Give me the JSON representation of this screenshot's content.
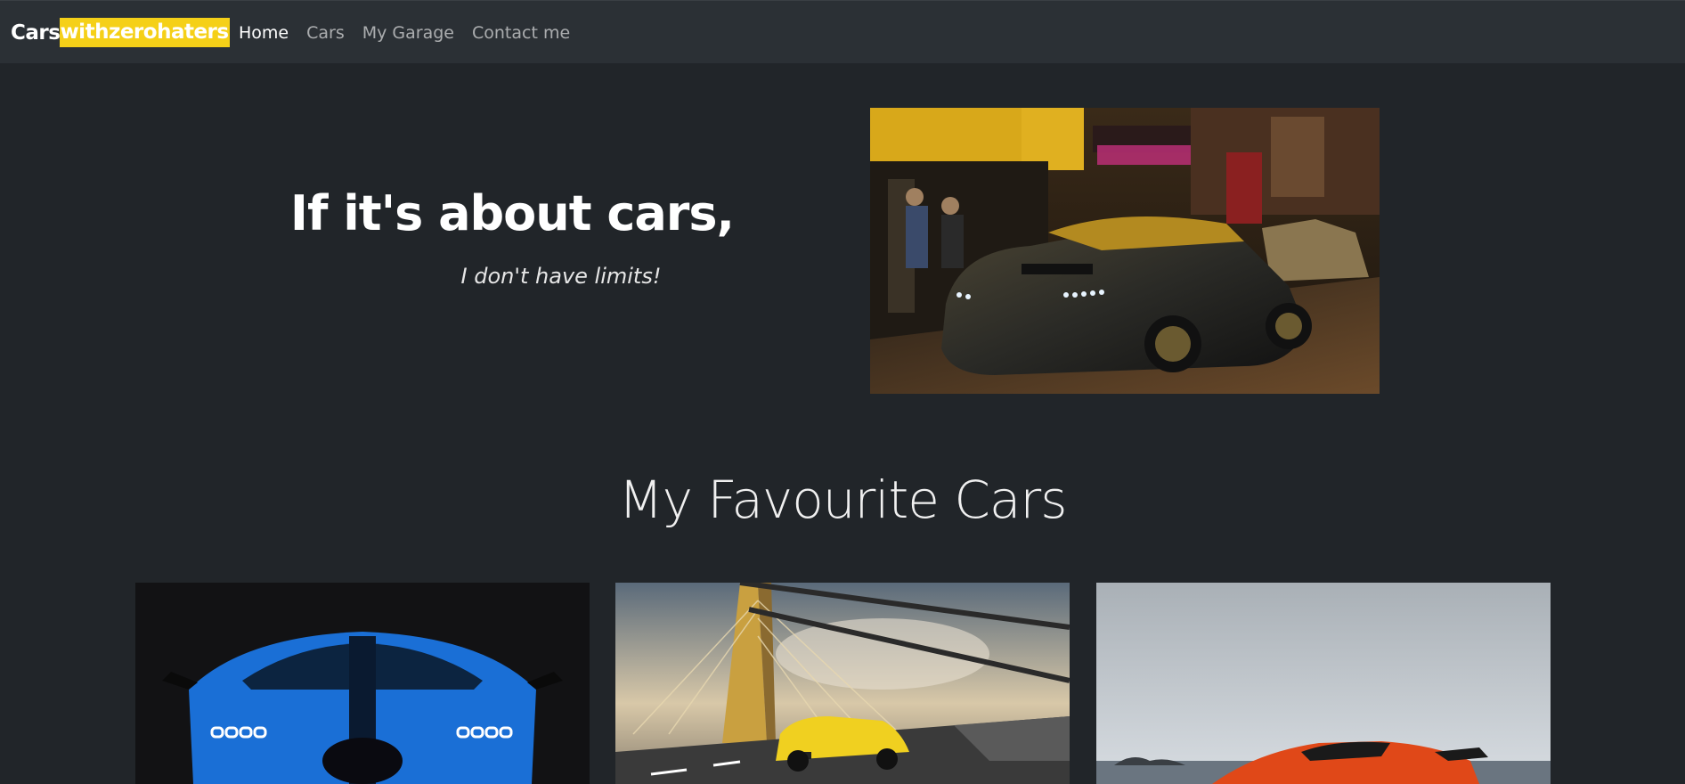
{
  "nav": {
    "brand_part1": "Cars",
    "brand_part2": "withzerohaters",
    "links": [
      "Home",
      "Cars",
      "My Garage",
      "Contact me"
    ],
    "active": "Home"
  },
  "hero": {
    "title": "If it's about cars,",
    "subtitle": "I don't have limits!"
  },
  "favourites": {
    "title": "My Favourite Cars"
  },
  "colors": {
    "background": "#212529",
    "navbar": "#2b3035",
    "brand_highlight": "#f5d018"
  }
}
